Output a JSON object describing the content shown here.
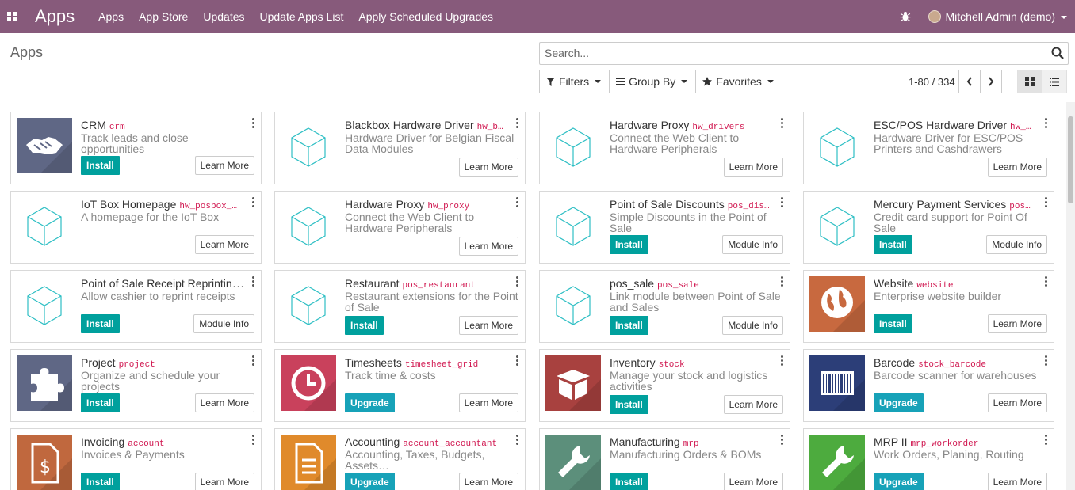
{
  "navbar": {
    "brand": "Apps",
    "menu": [
      "Apps",
      "App Store",
      "Updates",
      "Update Apps List",
      "Apply Scheduled Upgrades"
    ],
    "user": "Mitchell Admin (demo)",
    "color": "#875a7b"
  },
  "control_panel": {
    "breadcrumb": "Apps",
    "search_placeholder": "Search...",
    "filters_label": "Filters",
    "groupby_label": "Group By",
    "favorites_label": "Favorites",
    "pager": "1-80 / 334"
  },
  "colors": {
    "install": "#00a09d",
    "upgrade": "#17a2b8"
  },
  "apps": [
    {
      "name": "CRM",
      "tech": "crm",
      "summary": "Track leads and close opportunities",
      "action": "Install",
      "secondary": "Learn More",
      "icon": "handshake-icon",
      "icon_bg": "#5f6785"
    },
    {
      "name": "Blackbox Hardware Driver",
      "tech": "hw_b…",
      "summary": "Hardware Driver for Belgian Fiscal Data Modules",
      "action": "",
      "secondary": "Learn More",
      "icon": "module-cube-icon",
      "icon_bg": ""
    },
    {
      "name": "Hardware Proxy",
      "tech": "hw_drivers",
      "summary": "Connect the Web Client to Hardware Peripherals",
      "action": "",
      "secondary": "Learn More",
      "icon": "module-cube-icon",
      "icon_bg": ""
    },
    {
      "name": "ESC/POS Hardware Driver",
      "tech": "hw_…",
      "summary": "Hardware Driver for ESC/POS Printers and Cashdrawers",
      "action": "",
      "secondary": "Learn More",
      "icon": "module-cube-icon",
      "icon_bg": ""
    },
    {
      "name": "IoT Box Homepage",
      "tech": "hw_posbox_…",
      "summary": "A homepage for the IoT Box",
      "action": "",
      "secondary": "Learn More",
      "icon": "module-cube-icon",
      "icon_bg": ""
    },
    {
      "name": "Hardware Proxy",
      "tech": "hw_proxy",
      "summary": "Connect the Web Client to Hardware Peripherals",
      "action": "",
      "secondary": "Learn More",
      "icon": "module-cube-icon",
      "icon_bg": ""
    },
    {
      "name": "Point of Sale Discounts",
      "tech": "pos_dis…",
      "summary": "Simple Discounts in the Point of Sale",
      "action": "Install",
      "secondary": "Module Info",
      "icon": "module-cube-icon",
      "icon_bg": ""
    },
    {
      "name": "Mercury Payment Services",
      "tech": "pos…",
      "summary": "Credit card support for Point Of Sale",
      "action": "Install",
      "secondary": "Module Info",
      "icon": "module-cube-icon",
      "icon_bg": ""
    },
    {
      "name": "Point of Sale Receipt Reprinting…",
      "tech": "",
      "summary": "Allow cashier to reprint receipts",
      "action": "Install",
      "secondary": "Module Info",
      "icon": "module-cube-icon",
      "icon_bg": ""
    },
    {
      "name": "Restaurant",
      "tech": "pos_restaurant",
      "summary": "Restaurant extensions for the Point of Sale",
      "action": "Install",
      "secondary": "Learn More",
      "icon": "module-cube-icon",
      "icon_bg": ""
    },
    {
      "name": "pos_sale",
      "tech": "pos_sale",
      "summary": "Link module between Point of Sale and Sales",
      "action": "Install",
      "secondary": "Module Info",
      "icon": "module-cube-icon",
      "icon_bg": ""
    },
    {
      "name": "Website",
      "tech": "website",
      "summary": "Enterprise website builder",
      "action": "Install",
      "secondary": "Learn More",
      "icon": "globe-icon",
      "icon_bg": "#c8693f"
    },
    {
      "name": "Project",
      "tech": "project",
      "summary": "Organize and schedule your projects",
      "action": "Install",
      "secondary": "Learn More",
      "icon": "puzzle-icon",
      "icon_bg": "#5f6785"
    },
    {
      "name": "Timesheets",
      "tech": "timesheet_grid",
      "summary": "Track time & costs",
      "action": "Upgrade",
      "secondary": "Learn More",
      "icon": "clock-icon",
      "icon_bg": "#c9415c"
    },
    {
      "name": "Inventory",
      "tech": "stock",
      "summary": "Manage your stock and logistics activities",
      "action": "Install",
      "secondary": "Learn More",
      "icon": "box-icon",
      "icon_bg": "#a8413f"
    },
    {
      "name": "Barcode",
      "tech": "stock_barcode",
      "summary": "Barcode scanner for warehouses",
      "action": "Upgrade",
      "secondary": "Learn More",
      "icon": "barcode-icon",
      "icon_bg": "#2c3e78"
    },
    {
      "name": "Invoicing",
      "tech": "account",
      "summary": "Invoices & Payments",
      "action": "Install",
      "secondary": "Learn More",
      "icon": "invoice-icon",
      "icon_bg": "#c0683e"
    },
    {
      "name": "Accounting",
      "tech": "account_accountant",
      "summary": "Accounting, Taxes, Budgets, Assets…",
      "action": "Upgrade",
      "secondary": "Learn More",
      "icon": "document-icon",
      "icon_bg": "#e08a2b"
    },
    {
      "name": "Manufacturing",
      "tech": "mrp",
      "summary": "Manufacturing Orders & BOMs",
      "action": "Install",
      "secondary": "Learn More",
      "icon": "wrench-icon",
      "icon_bg": "#5c8f7b"
    },
    {
      "name": "MRP II",
      "tech": "mrp_workorder",
      "summary": "Work Orders, Planing, Routing",
      "action": "Upgrade",
      "secondary": "Learn More",
      "icon": "wrench-icon",
      "icon_bg": "#4dab3e"
    }
  ]
}
